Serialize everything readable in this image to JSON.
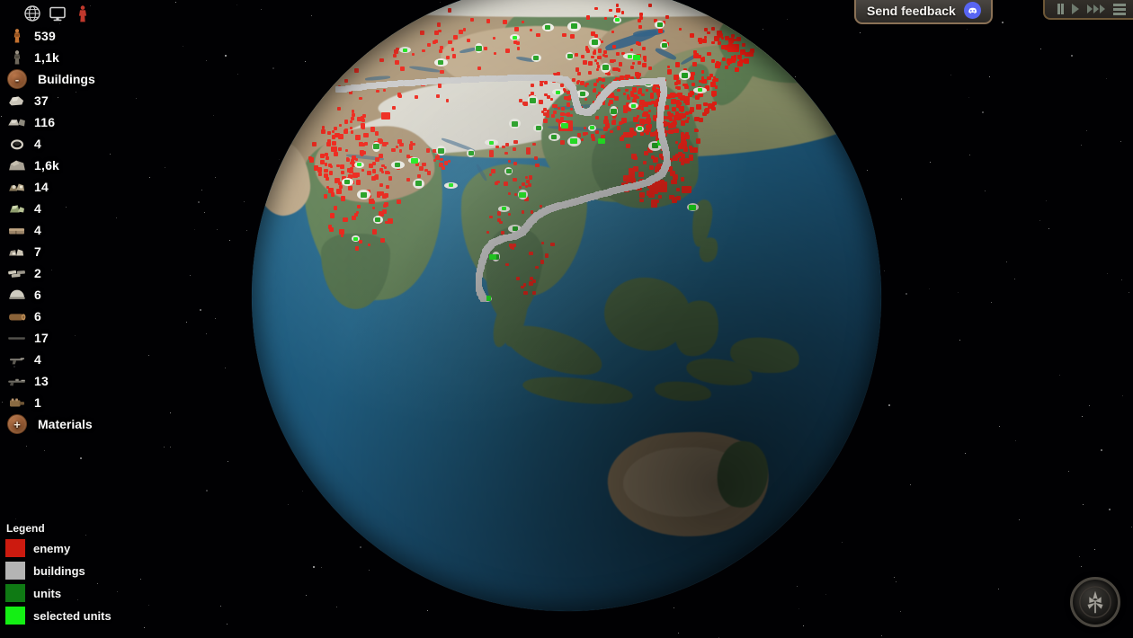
{
  "app": {
    "title": "Globe Strategy Map",
    "background_color": "#000000"
  },
  "topbar": {
    "icons": [
      {
        "name": "globe-icon",
        "label": "Globe view"
      },
      {
        "name": "monitor-icon",
        "label": "Screen view"
      },
      {
        "name": "red-figure-icon",
        "label": "Enemy units"
      }
    ]
  },
  "resources": [
    {
      "icon": "soldier-orange-icon",
      "value": "539",
      "label": ""
    },
    {
      "icon": "soldier-grey-icon",
      "value": "1,1k",
      "label": ""
    },
    {
      "icon": "buildings-coin-icon",
      "value": "",
      "label": "Buildings"
    },
    {
      "icon": "stone-icon",
      "value": "37",
      "label": ""
    },
    {
      "icon": "rubble-icon",
      "value": "116",
      "label": ""
    },
    {
      "icon": "ring-icon",
      "value": "4",
      "label": ""
    },
    {
      "icon": "boulder-icon",
      "value": "1,6k",
      "label": ""
    },
    {
      "icon": "ore-cluster-icon",
      "value": "14",
      "label": ""
    },
    {
      "icon": "green-mineral-icon",
      "value": "4",
      "label": ""
    },
    {
      "icon": "brick-icon",
      "value": "4",
      "label": ""
    },
    {
      "icon": "gravel-icon",
      "value": "7",
      "label": ""
    },
    {
      "icon": "ammo-crate-icon",
      "value": "2",
      "label": ""
    },
    {
      "icon": "helmet-icon",
      "value": "6",
      "label": ""
    },
    {
      "icon": "log-icon",
      "value": "6",
      "label": ""
    },
    {
      "icon": "rod-icon",
      "value": "17",
      "label": ""
    },
    {
      "icon": "pistol-icon",
      "value": "4",
      "label": ""
    },
    {
      "icon": "rifle-icon",
      "value": "13",
      "label": ""
    },
    {
      "icon": "engine-icon",
      "value": "1",
      "label": ""
    },
    {
      "icon": "materials-coin-icon",
      "value": "",
      "label": "Materials"
    }
  ],
  "legend": {
    "title": "Legend",
    "items": [
      {
        "label": "enemy",
        "color": "#cc1a0f"
      },
      {
        "label": "buildings",
        "color": "#b4b4b4"
      },
      {
        "label": "units",
        "color": "#0f7a14"
      },
      {
        "label": "selected units",
        "color": "#14ef14"
      }
    ]
  },
  "feedback": {
    "label": "Send feedback",
    "badge_icon": "discord-icon",
    "badge_color": "#5865f2"
  },
  "speed_controls": [
    {
      "name": "pause-button",
      "label": "Pause"
    },
    {
      "name": "play-button",
      "label": "Play"
    },
    {
      "name": "fast-forward-button",
      "label": "Fast forward"
    },
    {
      "name": "menu-button",
      "label": "Menu"
    }
  ],
  "compass": {
    "name": "compass-dial",
    "label": "Compass"
  },
  "globe": {
    "view": "Asia / Indian Ocean / Australia",
    "ocean_color": "#1d5f80",
    "land_color": "#6d8a5f",
    "desert_color": "#a89272",
    "snow_color": "#d8d6cc",
    "enemy_color": "#ee1d11",
    "unit_color": "#1aa01a",
    "selected_color": "#18f018",
    "building_color": "#c8c8c8"
  }
}
